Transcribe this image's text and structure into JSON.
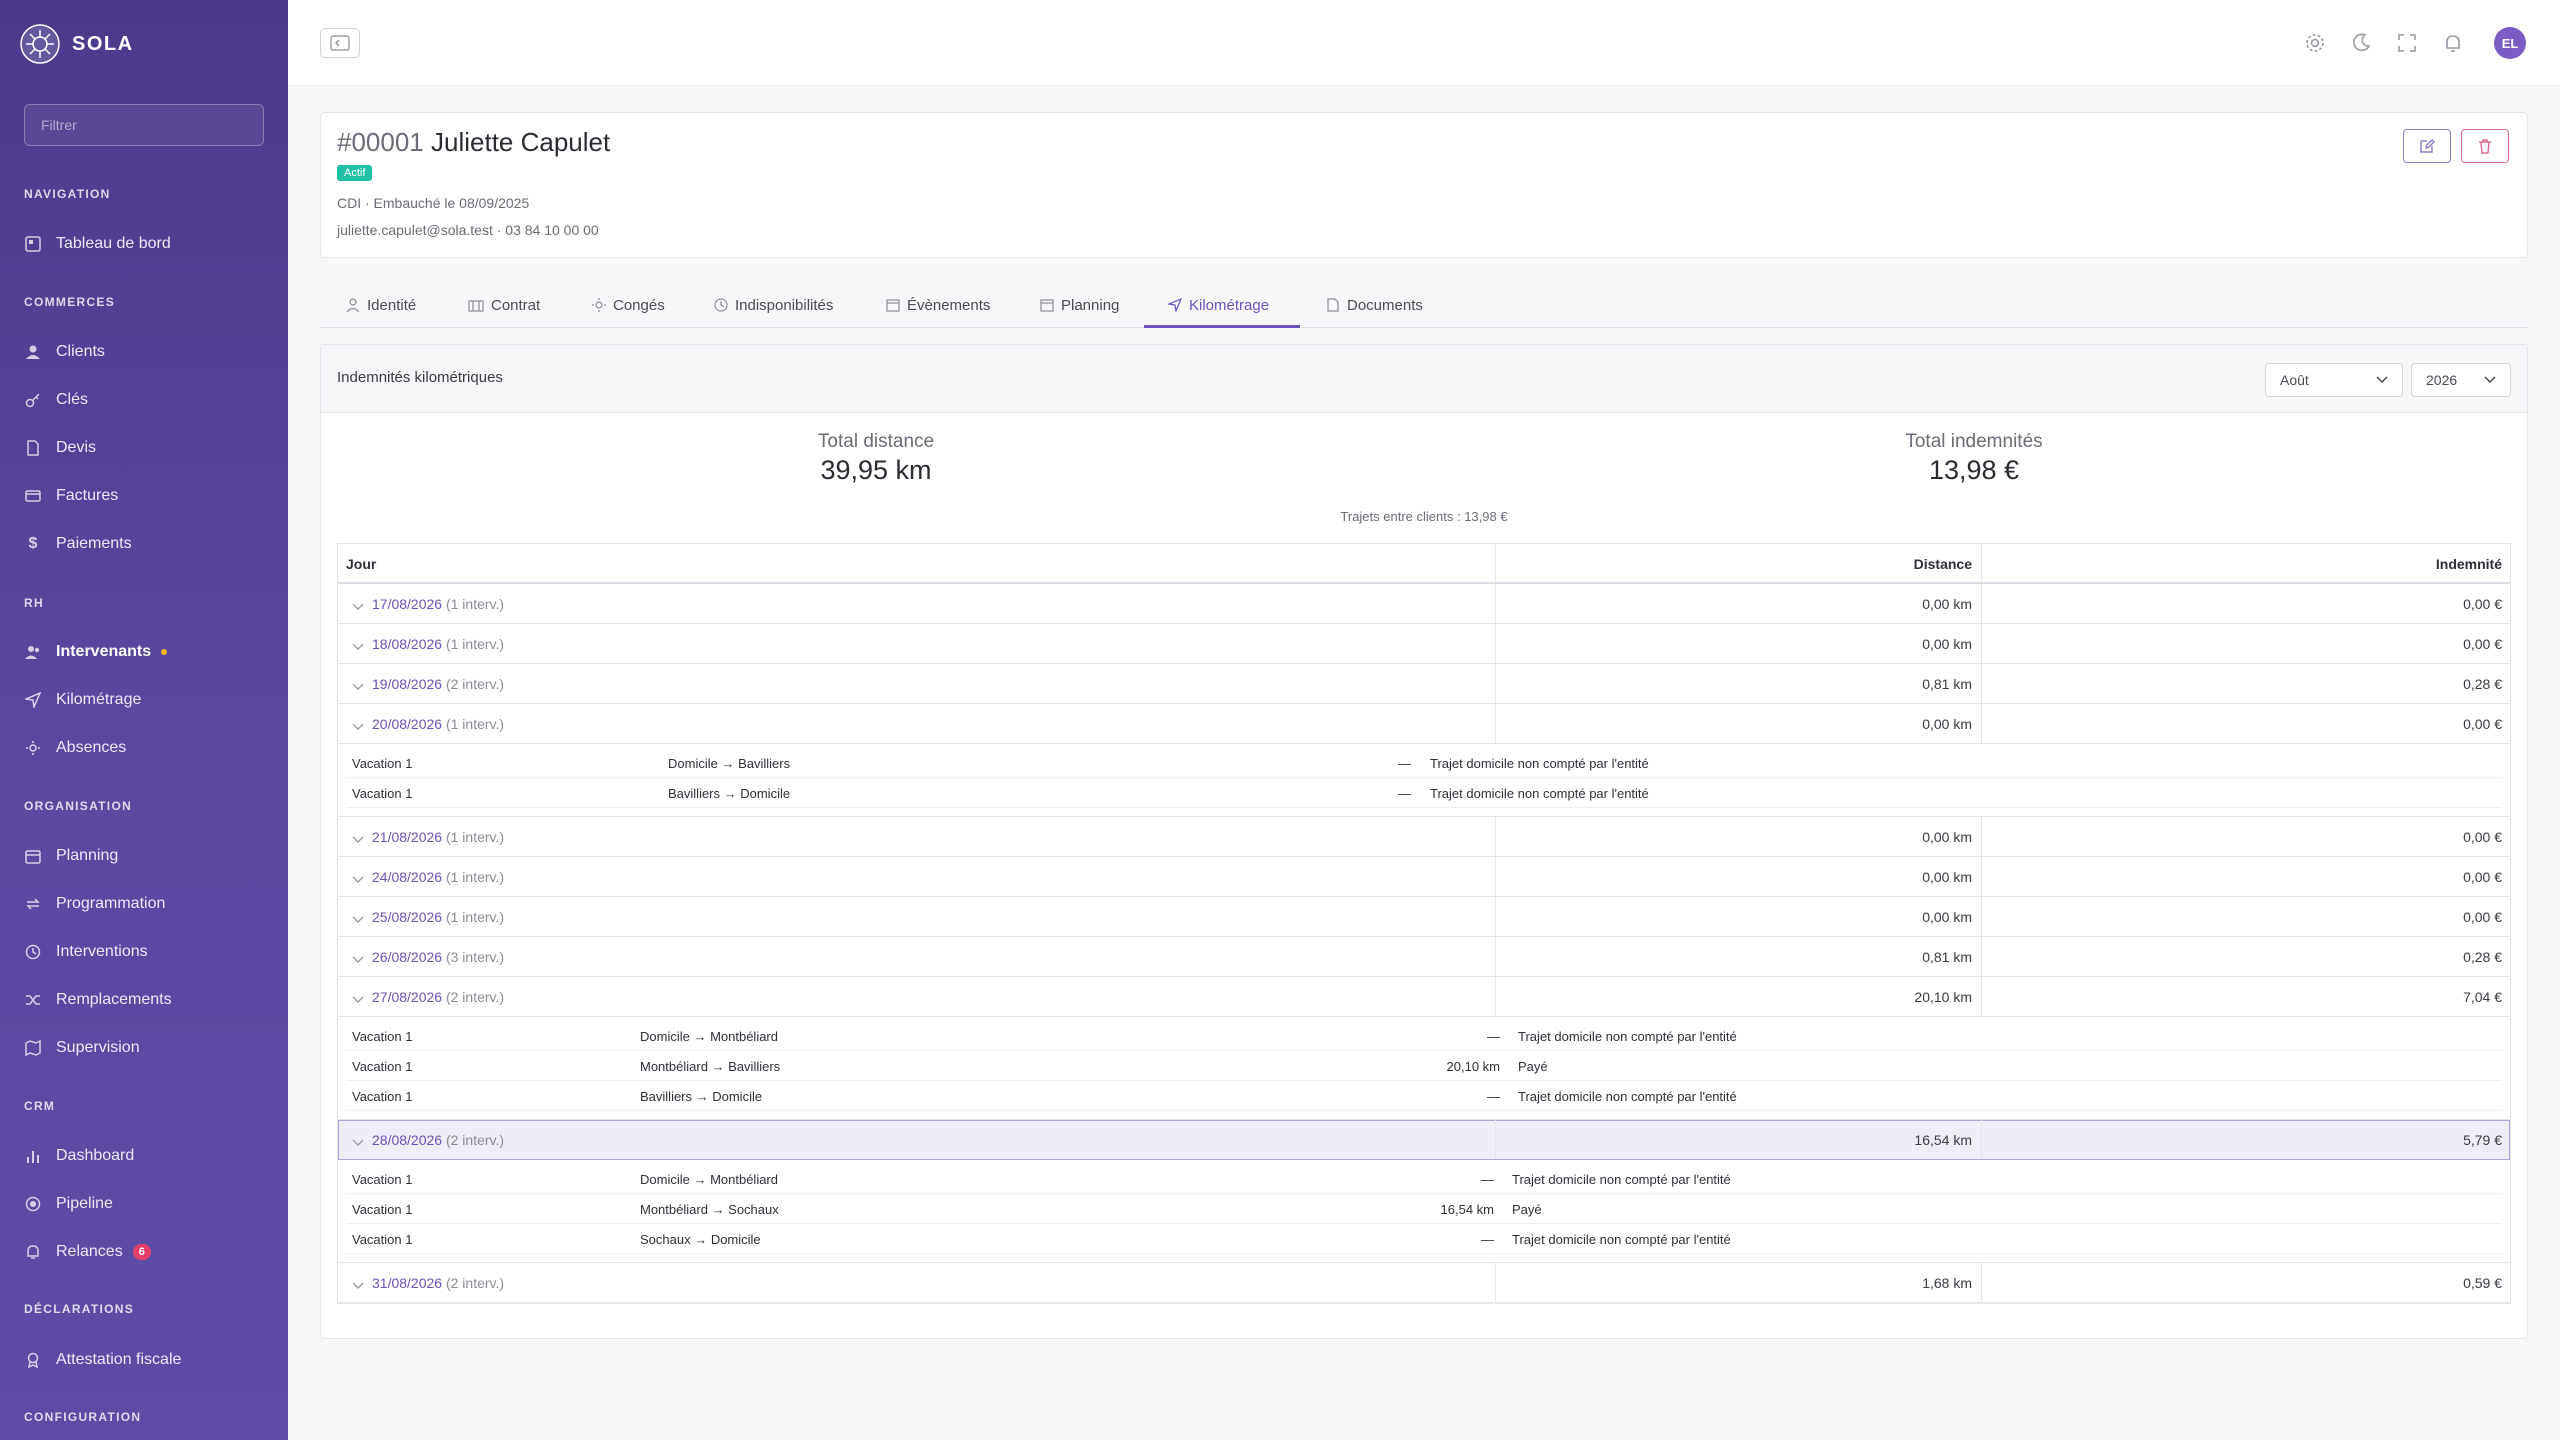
{
  "sidebar": {
    "brand": "SOLA",
    "filter_placeholder": "Filtrer",
    "sections": {
      "navigation": "NAVIGATION",
      "commerces": "COMMERCES",
      "rh": "RH",
      "organisation": "ORGANISATION",
      "crm": "CRM",
      "declarations": "DÉCLARATIONS",
      "configuration": "CONFIGURATION"
    },
    "items": {
      "tableau": "Tableau de bord",
      "clients": "Clients",
      "cles": "Clés",
      "devis": "Devis",
      "factures": "Factures",
      "paiements": "Paiements",
      "intervenants": "Intervenants",
      "kilometrage": "Kilométrage",
      "absences": "Absences",
      "planning": "Planning",
      "programmation": "Programmation",
      "interventions": "Interventions",
      "remplacements": "Remplacements",
      "supervision": "Supervision",
      "dashboard": "Dashboard",
      "pipeline": "Pipeline",
      "relances": "Relances",
      "relances_count": "6",
      "attestation": "Attestation fiscale"
    }
  },
  "topbar": {
    "avatar": "EL"
  },
  "employee": {
    "id": "#00001",
    "name": "Juliette Capulet",
    "status": "Actif",
    "contract": "CDI · Embauché le 08/09/2025",
    "contact": "juliette.capulet@sola.test · 03 84 10 00 00"
  },
  "tabs": {
    "identite": "Identité",
    "contrat": "Contrat",
    "conges": "Congés",
    "indispo": "Indisponibilités",
    "evenements": "Évènements",
    "planning": "Planning",
    "kilometrage": "Kilométrage",
    "documents": "Documents"
  },
  "km": {
    "title": "Indemnités kilométriques",
    "month": "Août",
    "year": "2026",
    "total_distance_label": "Total distance",
    "total_distance": "39,95 km",
    "total_indemnites_label": "Total indemnités",
    "total_indemnites": "13,98 €",
    "trajets_clients": "Trajets entre clients : 13,98 €",
    "columns": {
      "jour": "Jour",
      "distance": "Distance",
      "indemnite": "Indemnité"
    },
    "rows": [
      {
        "date": "17/08/2026",
        "count": "(1 interv.)",
        "distance": "0,00 km",
        "indemnite": "0,00 €"
      },
      {
        "date": "18/08/2026",
        "count": "(1 interv.)",
        "distance": "0,00 km",
        "indemnite": "0,00 €"
      },
      {
        "date": "19/08/2026",
        "count": "(2 interv.)",
        "distance": "0,81 km",
        "indemnite": "0,28 €"
      },
      {
        "date": "20/08/2026",
        "count": "(1 interv.)",
        "distance": "0,00 km",
        "indemnite": "0,00 €"
      },
      {
        "date": "21/08/2026",
        "count": "(1 interv.)",
        "distance": "0,00 km",
        "indemnite": "0,00 €"
      },
      {
        "date": "24/08/2026",
        "count": "(1 interv.)",
        "distance": "0,00 km",
        "indemnite": "0,00 €"
      },
      {
        "date": "25/08/2026",
        "count": "(1 interv.)",
        "distance": "0,00 km",
        "indemnite": "0,00 €"
      },
      {
        "date": "26/08/2026",
        "count": "(3 interv.)",
        "distance": "0,81 km",
        "indemnite": "0,28 €"
      },
      {
        "date": "27/08/2026",
        "count": "(2 interv.)",
        "distance": "20,10 km",
        "indemnite": "7,04 €"
      },
      {
        "date": "28/08/2026",
        "count": "(2 interv.)",
        "distance": "16,54 km",
        "indemnite": "5,79 €"
      },
      {
        "date": "31/08/2026",
        "count": "(2 interv.)",
        "distance": "1,68 km",
        "indemnite": "0,59 €"
      }
    ],
    "details": {
      "d20": [
        {
          "vacation": "Vacation 1",
          "route": "Domicile → Bavilliers",
          "distance": "—",
          "note": "Trajet domicile non compté par l'entité"
        },
        {
          "vacation": "Vacation 1",
          "route": "Bavilliers → Domicile",
          "distance": "—",
          "note": "Trajet domicile non compté par l'entité"
        }
      ],
      "d27": [
        {
          "vacation": "Vacation 1",
          "route": "Domicile → Montbéliard",
          "distance": "—",
          "note": "Trajet domicile non compté par l'entité"
        },
        {
          "vacation": "Vacation 1",
          "route": "Montbéliard → Bavilliers",
          "distance": "20,10 km",
          "note": "Payé"
        },
        {
          "vacation": "Vacation 1",
          "route": "Bavilliers → Domicile",
          "distance": "—",
          "note": "Trajet domicile non compté par l'entité"
        }
      ],
      "d28": [
        {
          "vacation": "Vacation 1",
          "route": "Domicile → Montbéliard",
          "distance": "—",
          "note": "Trajet domicile non compté par l'entité"
        },
        {
          "vacation": "Vacation 1",
          "route": "Montbéliard → Sochaux",
          "distance": "16,54 km",
          "note": "Payé"
        },
        {
          "vacation": "Vacation 1",
          "route": "Sochaux → Domicile",
          "distance": "—",
          "note": "Trajet domicile non compté par l'entité"
        }
      ]
    }
  }
}
